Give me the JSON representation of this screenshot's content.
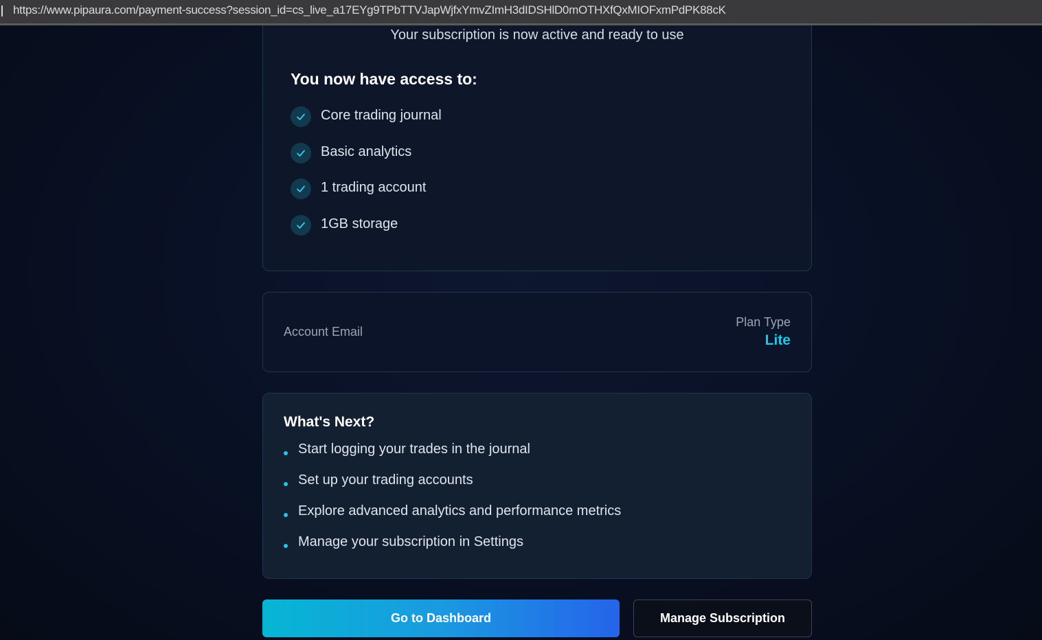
{
  "browser": {
    "url": "https://www.pipaura.com/payment-success?session_id=cs_live_a17EYg9TPbTTVJapWjfxYmvZImH3dIDSHlD0mOTHXfQxMIOFxmPdPK88cK"
  },
  "access_card": {
    "subtitle": "Your subscription is now active and ready to use",
    "title": "You now have access to:",
    "features": [
      {
        "label": "Core trading journal",
        "icon": "check-icon"
      },
      {
        "label": "Basic analytics",
        "icon": "check-icon"
      },
      {
        "label": "1 trading account",
        "icon": "check-icon"
      },
      {
        "label": "1GB storage",
        "icon": "check-icon"
      }
    ]
  },
  "account_card": {
    "email_label": "Account Email",
    "plan_label": "Plan Type",
    "plan_value": "Lite"
  },
  "next_card": {
    "title": "What's Next?",
    "items": [
      "Start logging your trades in the journal",
      "Set up your trading accounts",
      "Explore advanced analytics and performance metrics",
      "Manage your subscription in Settings"
    ]
  },
  "actions": {
    "dashboard_label": "Go to Dashboard",
    "manage_label": "Manage Subscription"
  },
  "colors": {
    "accent": "#22c6e6",
    "background": "#070d1b",
    "gradient_start": "#06b6d4",
    "gradient_end": "#2563eb"
  }
}
